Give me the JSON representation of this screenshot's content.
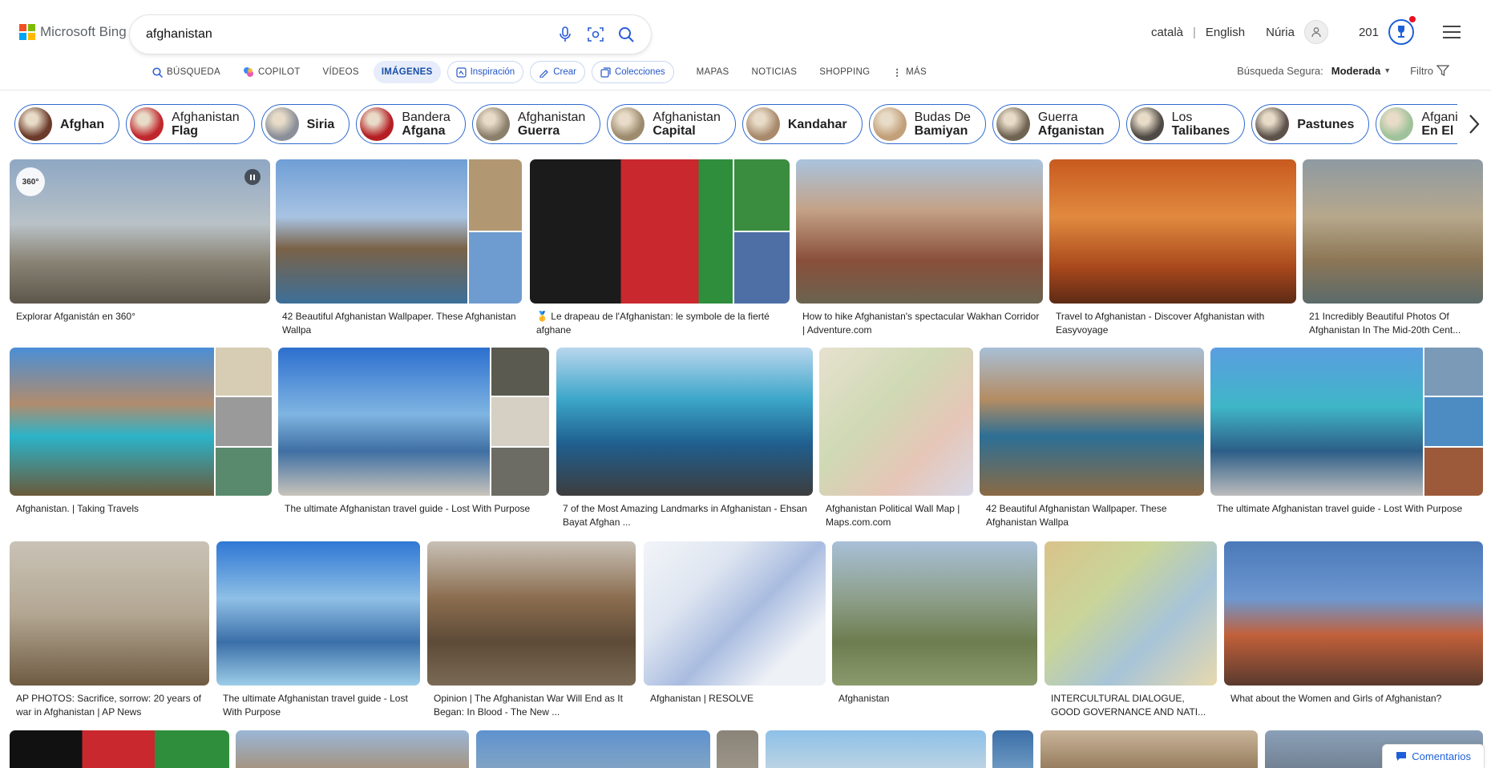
{
  "brand": {
    "name": "Microsoft Bing",
    "logo_colors": [
      "#f25022",
      "#7fba00",
      "#00a4ef",
      "#ffb900"
    ]
  },
  "search": {
    "query": "afghanistan"
  },
  "header": {
    "languages": [
      "català",
      "English"
    ],
    "user_name": "Núria",
    "reward_points": "201"
  },
  "nav": {
    "tabs": [
      {
        "label": "BÚSQUEDA",
        "icon": "search-icon"
      },
      {
        "label": "COPILOT",
        "icon": "copilot-icon"
      },
      {
        "label": "VÍDEOS"
      },
      {
        "label": "IMÁGENES",
        "active": true
      },
      {
        "label": "Inspiración",
        "pill": true,
        "icon": "inspiration-icon"
      },
      {
        "label": "Crear",
        "pill": true,
        "icon": "create-icon"
      },
      {
        "label": "Colecciones",
        "pill": true,
        "icon": "collections-icon"
      },
      {
        "label": "MAPAS"
      },
      {
        "label": "NOTICIAS"
      },
      {
        "label": "SHOPPING"
      },
      {
        "label": "MÁS",
        "icon": "more-dots-icon"
      }
    ]
  },
  "filters": {
    "safe_search_label": "Búsqueda Segura:",
    "safe_search_value": "Moderada",
    "filter_label": "Filtro"
  },
  "chips": [
    {
      "l1": "Afghan",
      "l2": "",
      "color": "#6b3a2a"
    },
    {
      "l1": "Afghanistan",
      "l2": "Flag",
      "color": "#c0272d"
    },
    {
      "l1": "Siria",
      "l2": "",
      "color": "#8b8f99"
    },
    {
      "l1": "Bandera",
      "l2": "Afgana",
      "color": "#b51f24"
    },
    {
      "l1": "Afghanistan",
      "l2": "Guerra",
      "color": "#8a7f6a"
    },
    {
      "l1": "Afghanistan",
      "l2": "Capital",
      "color": "#9c8b6d"
    },
    {
      "l1": "Kandahar",
      "l2": "",
      "color": "#a8896c"
    },
    {
      "l1": "Budas De",
      "l2": "Bamiyan",
      "color": "#c2a07a"
    },
    {
      "l1": "Guerra",
      "l2": "Afganistan",
      "color": "#6f6452"
    },
    {
      "l1": "Los",
      "l2": "Talibanes",
      "color": "#4f4a45"
    },
    {
      "l1": "Pastunes",
      "l2": "",
      "color": "#5c524a"
    },
    {
      "l1": "Afganistán",
      "l2": "En El Mapa",
      "color": "#9fc29a"
    }
  ],
  "images": [
    {
      "caption": "Explorar Afganistán en 360°",
      "badge": "360°"
    },
    {
      "caption": "42 Beautiful Afghanistan Wallpaper. These Afghanistan Wallpa"
    },
    {
      "caption": "🥇 Le drapeau de l'Afghanistan: le symbole de la fierté afghane"
    },
    {
      "caption": "How to hike Afghanistan's spectacular Wakhan Corridor | Adventure.com"
    },
    {
      "caption": "Travel to Afghanistan - Discover Afghanistan with Easyvoyage"
    },
    {
      "caption": "21 Incredibly Beautiful Photos Of Afghanistan In The Mid-20th Cent..."
    },
    {
      "caption": "Afghanistan. | Taking Travels"
    },
    {
      "caption": "The ultimate Afghanistan travel guide - Lost With Purpose"
    },
    {
      "caption": "7 of the Most Amazing Landmarks in Afghanistan - Ehsan Bayat Afghan ..."
    },
    {
      "caption": "Afghanistan Political Wall Map | Maps.com.com"
    },
    {
      "caption": "42 Beautiful Afghanistan Wallpaper. These Afghanistan Wallpa"
    },
    {
      "caption": "The ultimate Afghanistan travel guide - Lost With Purpose"
    },
    {
      "caption": "AP PHOTOS: Sacrifice, sorrow: 20 years of war in Afghanistan | AP News"
    },
    {
      "caption": "The ultimate Afghanistan travel guide - Lost With Purpose"
    },
    {
      "caption": "Opinion | The Afghanistan War Will End as It Began: In Blood - The New ..."
    },
    {
      "caption": "Afghanistan | RESOLVE"
    },
    {
      "caption": "Afghanistan"
    },
    {
      "caption": "INTERCULTURAL DIALOGUE, GOOD GOVERNANCE AND NATI..."
    },
    {
      "caption": "What about the Women and Girls of Afghanistan?"
    }
  ],
  "feedback": {
    "label": "Comentarios"
  }
}
